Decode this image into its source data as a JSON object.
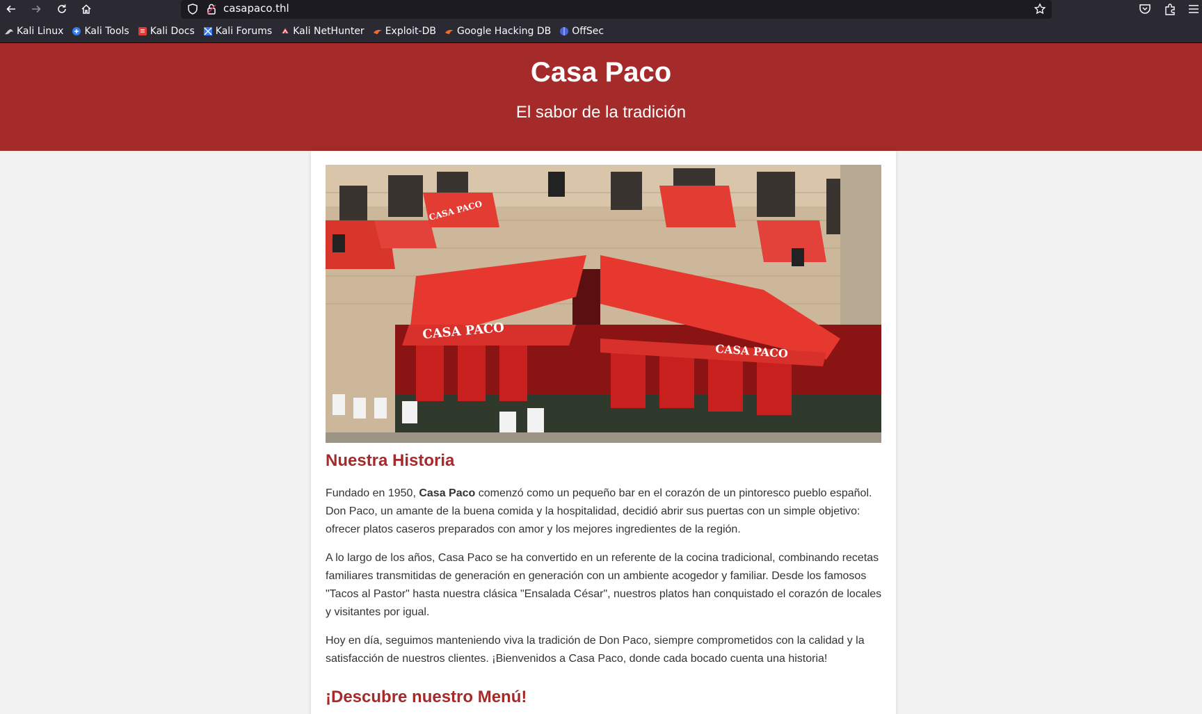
{
  "browser": {
    "url": "casapaco.thl",
    "bookmarks": [
      {
        "label": "Kali Linux",
        "icon": "kali-dragon-icon"
      },
      {
        "label": "Kali Tools",
        "icon": "kali-tools-icon"
      },
      {
        "label": "Kali Docs",
        "icon": "kali-docs-icon"
      },
      {
        "label": "Kali Forums",
        "icon": "kali-forums-icon"
      },
      {
        "label": "Kali NetHunter",
        "icon": "kali-nethunter-icon"
      },
      {
        "label": "Exploit-DB",
        "icon": "exploit-db-icon"
      },
      {
        "label": "Google Hacking DB",
        "icon": "ghdb-icon"
      },
      {
        "label": "OffSec",
        "icon": "offsec-icon"
      }
    ]
  },
  "header": {
    "title": "Casa Paco",
    "subtitle": "El sabor de la tradición"
  },
  "hero": {
    "awning_left": "CASA PACO",
    "awning_right": "CASA PACO",
    "awning_small": "CASA PACO"
  },
  "history": {
    "heading": "Nuestra Historia",
    "p1_pre": "Fundado en 1950, ",
    "p1_bold": "Casa Paco",
    "p1_post": " comenzó como un pequeño bar en el corazón de un pintoresco pueblo español. Don Paco, un amante de la buena comida y la hospitalidad, decidió abrir sus puertas con un simple objetivo: ofrecer platos caseros preparados con amor y los mejores ingredientes de la región.",
    "p2": "A lo largo de los años, Casa Paco se ha convertido en un referente de la cocina tradicional, combinando recetas familiares transmitidas de generación en generación con un ambiente acogedor y familiar. Desde los famosos \"Tacos al Pastor\" hasta nuestra clásica \"Ensalada César\", nuestros platos han conquistado el corazón de locales y visitantes por igual.",
    "p3": "Hoy en día, seguimos manteniendo viva la tradición de Don Paco, siempre comprometidos con la calidad y la satisfacción de nuestros clientes. ¡Bienvenidos a Casa Paco, donde cada bocado cuenta una historia!"
  },
  "menu": {
    "heading": "¡Descubre nuestro Menú!"
  },
  "colors": {
    "brand": "#a52a2a",
    "browser_chrome": "#2b2a33",
    "urlbar": "#1c1b22"
  }
}
